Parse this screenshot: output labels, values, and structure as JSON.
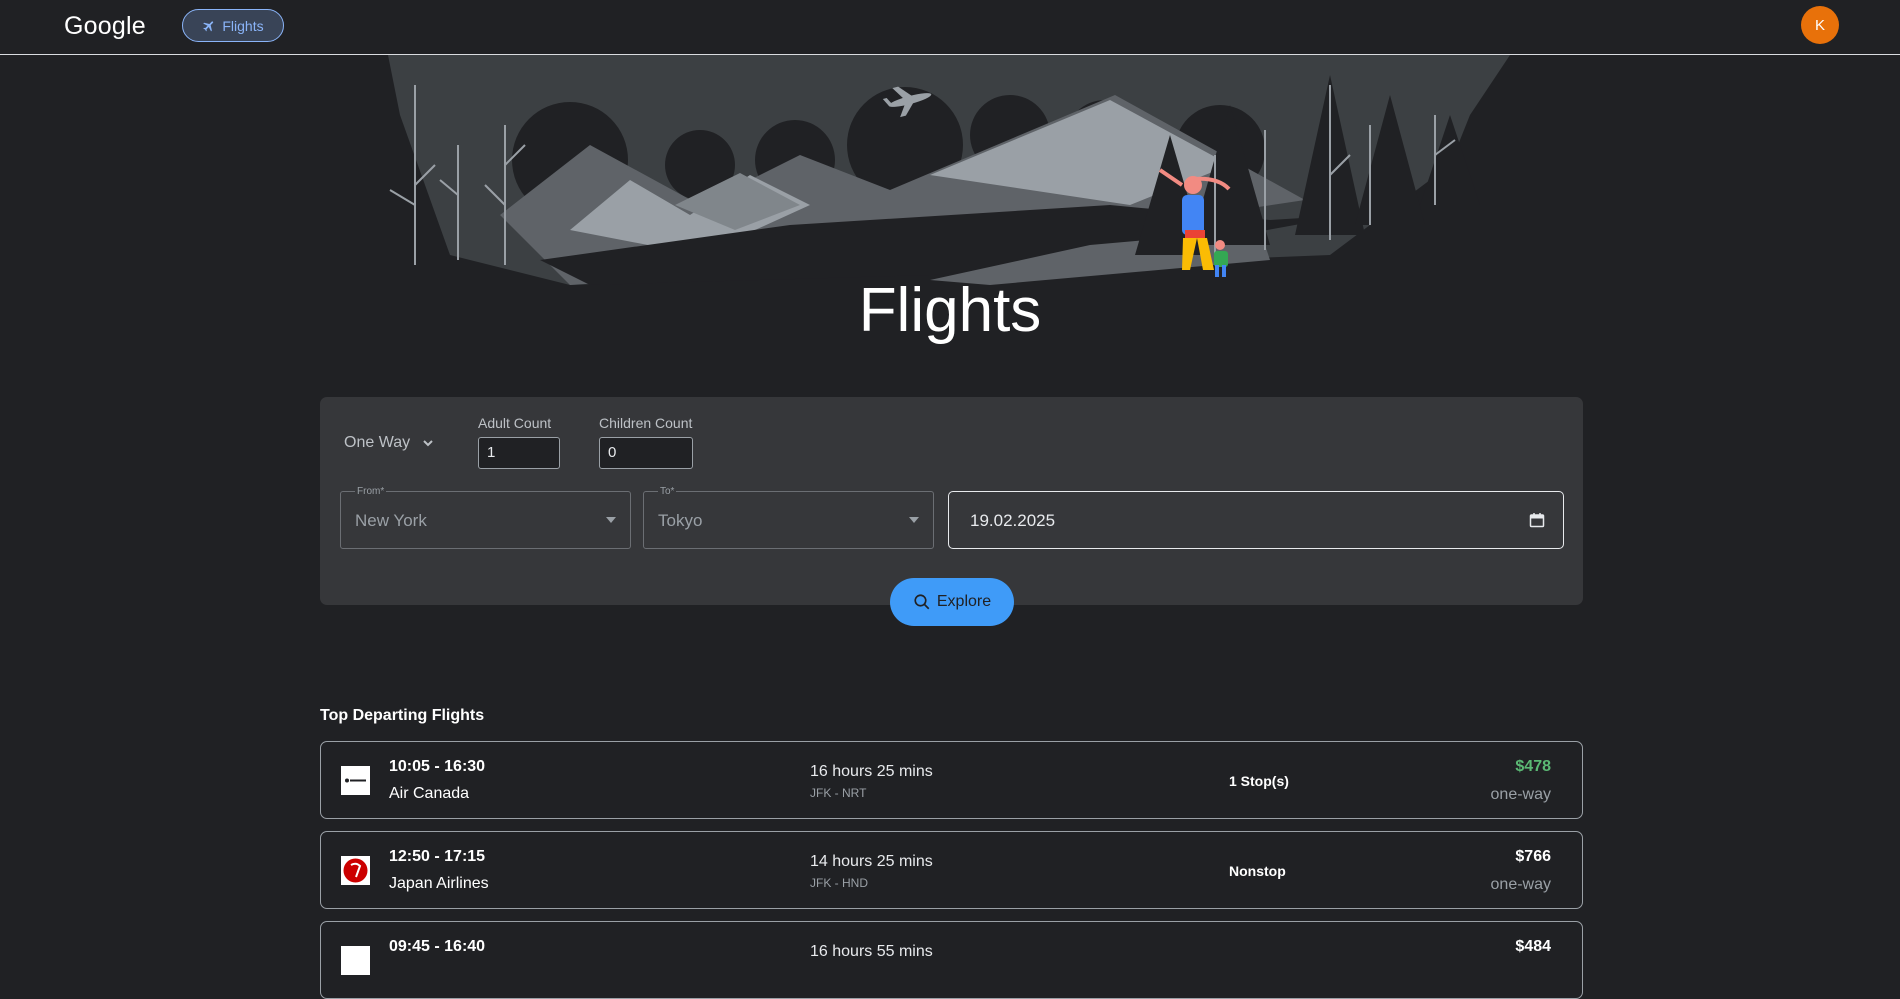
{
  "header": {
    "logo": "Google",
    "nav_chip_label": "Flights",
    "avatar_initial": "K"
  },
  "hero": {
    "title": "Flights"
  },
  "search": {
    "trip_type": "One Way",
    "adult_label": "Adult Count",
    "adult_value": "1",
    "children_label": "Children Count",
    "children_value": "0",
    "from_label": "From*",
    "from_value": "New York",
    "to_label": "To*",
    "to_value": "Tokyo",
    "date_value": "19.02.2025",
    "explore_label": "Explore"
  },
  "results": {
    "title": "Top Departing Flights",
    "flights": [
      {
        "times": "10:05 - 16:30",
        "airline": "Air Canada",
        "duration": "16 hours 25 mins",
        "route": "JFK - NRT",
        "stops": "1 Stop(s)",
        "price": "$478",
        "fare_type": "one-way",
        "highlight": true
      },
      {
        "times": "12:50 - 17:15",
        "airline": "Japan Airlines",
        "duration": "14 hours 25 mins",
        "route": "JFK - HND",
        "stops": "Nonstop",
        "price": "$766",
        "fare_type": "one-way",
        "highlight": false
      },
      {
        "times": "09:45 - 16:40",
        "airline": "",
        "duration": "16 hours 55 mins",
        "route": "",
        "stops": "",
        "price": "$484",
        "fare_type": "",
        "highlight": false
      }
    ]
  },
  "colors": {
    "background": "#202124",
    "accent": "#8ab4f8",
    "explore_button": "#3f9bf8",
    "avatar": "#e8710a",
    "best_price": "#5bb974"
  }
}
